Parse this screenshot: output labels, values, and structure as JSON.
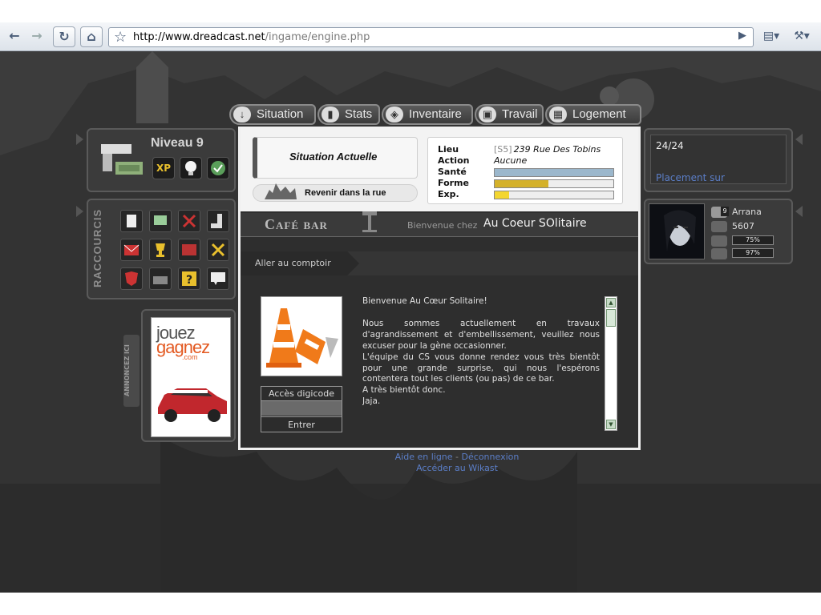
{
  "browser": {
    "url_host": "http://www.dreadcast.net",
    "url_path": "/ingame/engine.php"
  },
  "level": {
    "title": "Niveau 9",
    "xp_label": "XP"
  },
  "shortcuts": {
    "label": "RACCOURCIS"
  },
  "ad": {
    "vertical_label": "ANNONCEZ ICI",
    "line1": "jouez",
    "line2": "gagnez",
    "line3": ".com"
  },
  "tabs": [
    {
      "label": "Situation",
      "icon": "down-arrow-icon"
    },
    {
      "label": "Stats",
      "icon": "chart-icon"
    },
    {
      "label": "Inventaire",
      "icon": "bag-icon"
    },
    {
      "label": "Travail",
      "icon": "briefcase-icon"
    },
    {
      "label": "Logement",
      "icon": "building-icon"
    }
  ],
  "situation": {
    "title": "Situation Actuelle",
    "return_label": "Revenir dans la rue"
  },
  "stats": {
    "lieu_key": "Lieu",
    "lieu_sector": "[S5]",
    "lieu_val": "239 Rue Des Tobins",
    "action_key": "Action",
    "action_val": "Aucune",
    "sante_key": "Santé",
    "forme_key": "Forme",
    "exp_key": "Exp."
  },
  "bars": {
    "sante": {
      "value": 1.0,
      "color": "#9bb7cc"
    },
    "forme": {
      "value": 0.45,
      "color": "#d4b12a"
    },
    "exp": {
      "value": 0.12,
      "color": "#f3d630"
    }
  },
  "venue": {
    "title": "Café bar",
    "welcome_pre": "Bienvenue chez",
    "welcome_name": "Au Coeur SOlitaire",
    "counter_label": "Aller au comptoir"
  },
  "digicode": {
    "header": "Accès digicode",
    "enter": "Entrer"
  },
  "message": {
    "p1": "Bienvenue Au Cœur Solitaire!",
    "p2": "Nous sommes actuellement en travaux d'agrandissement et d'embellissement, veuillez nous excuser pour la gène occasionner.",
    "p3": "L'équipe du CS vous donne rendez vous très bientôt pour une grande surprise, qui nous l'espérons contentera tout les clients (ou pas) de ce bar.",
    "p4": "A très bientôt donc.",
    "p5": "Jaja."
  },
  "footer": {
    "help": "Aide en ligne",
    "sep": "-",
    "logout": "Déconnexion",
    "wiki": "Accéder au Wikast"
  },
  "right_top": {
    "count": "24/24",
    "link": "Placement sur"
  },
  "character": {
    "level_badge": "9",
    "name": "Arrana",
    "money": "5607",
    "bar1": "75%",
    "bar2": "97%"
  },
  "colors": {
    "link": "#5b7ec7",
    "panel": "#3b3b3b",
    "main_bg": "#2e2e2e"
  }
}
